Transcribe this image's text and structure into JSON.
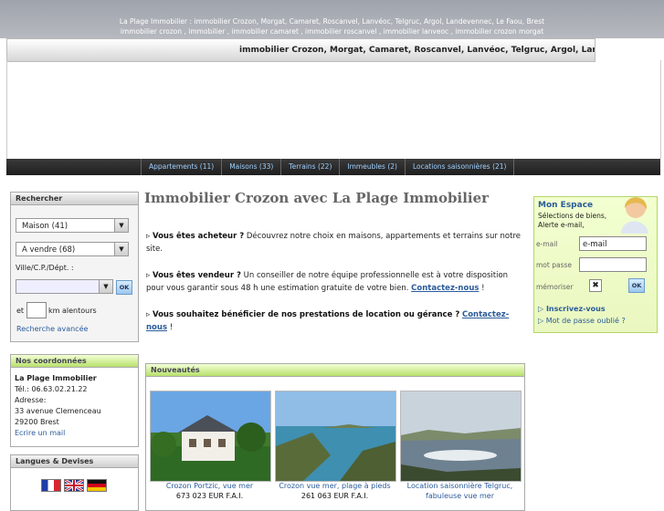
{
  "top_bar": {
    "line1": "La Plage Immobilier : immobilier Crozon, Morgat, Camaret, Roscanvel, Lanvéoc, Telgruc, Argol, Landevennec, Le Faou, Brest",
    "line2": "immobilier crozon , immobilier , immobilier camaret , immobilier roscanvel , immobilier lanveoc , immobilier crozon morgat"
  },
  "marquee": {
    "text": "immobilier Crozon, Morgat, Camaret, Roscanvel, Lanvéoc, Telgruc, Argol, Landevennec"
  },
  "nav": {
    "items": [
      {
        "label": "Appartements (11)"
      },
      {
        "label": "Maisons (33)"
      },
      {
        "label": "Terrains (22)"
      },
      {
        "label": "Immeubles (2)"
      },
      {
        "label": "Locations saisonnières (21)"
      }
    ]
  },
  "search": {
    "title": "Rechercher",
    "type_selected": "Maison (41)",
    "transaction_selected": "A vendre (68)",
    "location_label": "Ville/C.P./Dépt. :",
    "ok_label": "OK",
    "km_prefix": "et",
    "km_suffix": "km alentours",
    "advanced_link": "Recherche avancée"
  },
  "contact": {
    "title": "Nos coordonnées",
    "company": "La Plage Immobilier",
    "phone": "Tél.: 06.63.02.21.22",
    "address_label": "Adresse:",
    "street": "33 avenue Clemenceau",
    "city": "29200 Brest",
    "email_link": "Ecrire un mail"
  },
  "langs": {
    "title": "Langues & Devises",
    "flags": [
      "fr-flag",
      "uk-flag",
      "de-flag"
    ]
  },
  "main": {
    "title": "Immobilier Crozon avec La Plage Immobilier",
    "buyer_bold": "Vous êtes acheteur ?",
    "buyer_text": " Découvrez notre choix en maisons, appartements et terrains sur notre site.",
    "seller_bold": "Vous êtes vendeur ?",
    "seller_text": " Un conseiller de notre équipe professionnelle est à votre disposition pour vous garantir sous 48 h une estimation gratuite de votre bien. ",
    "seller_link": "Contactez-nous",
    "seller_end": " !",
    "rental_bold": "Vous souhaitez bénéficier de nos prestations de location ou gérance ?",
    "rental_link": "Contactez-nous",
    "rental_end": " !"
  },
  "news": {
    "title": "Nouveautés",
    "items": [
      {
        "caption": "Crozon Portzic, vue mer",
        "price": "673 023 EUR F.A.I."
      },
      {
        "caption": "Crozon vue mer, plage à pieds",
        "price": "261 063 EUR F.A.I."
      },
      {
        "caption": "Location saisonnière Telgruc,",
        "price": "fabuleuse vue mer"
      }
    ]
  },
  "espace": {
    "title": "Mon Espace",
    "subtitle1": "Sélections de biens,",
    "subtitle2": "Alerte e-mail,",
    "email_label": "e-mail",
    "email_value": "e-mail",
    "password_label": "mot passe",
    "remember_label": "mémoriser",
    "ok_label": "OK",
    "register_link": "Inscrivez-vous",
    "forgot_link": "Mot de passe oublié ?"
  },
  "colors": {
    "green_accent": "#b8e16b",
    "link": "#2a5b9a",
    "nav_bg": "#2a2a2a"
  }
}
